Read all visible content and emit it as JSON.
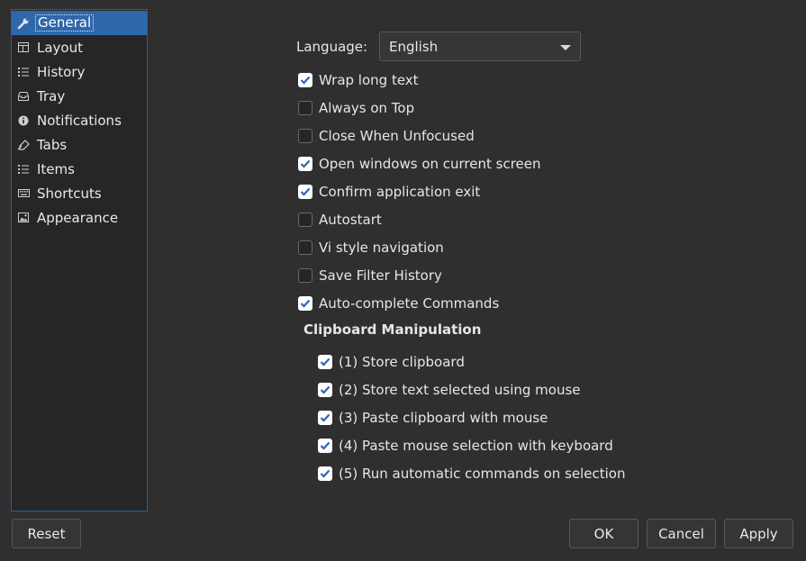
{
  "sidebar": {
    "items": [
      {
        "label": "General",
        "icon": "wrench-icon",
        "selected": true
      },
      {
        "label": "Layout",
        "icon": "layout-icon",
        "selected": false
      },
      {
        "label": "History",
        "icon": "list-icon",
        "selected": false
      },
      {
        "label": "Tray",
        "icon": "tray-icon",
        "selected": false
      },
      {
        "label": "Notifications",
        "icon": "info-icon",
        "selected": false
      },
      {
        "label": "Tabs",
        "icon": "tabs-icon",
        "selected": false
      },
      {
        "label": "Items",
        "icon": "list-icon",
        "selected": false
      },
      {
        "label": "Shortcuts",
        "icon": "keyboard-icon",
        "selected": false
      },
      {
        "label": "Appearance",
        "icon": "image-icon",
        "selected": false
      }
    ]
  },
  "language": {
    "label": "Language:",
    "value": "English"
  },
  "options": [
    {
      "label": "Wrap long text",
      "checked": true
    },
    {
      "label": "Always on Top",
      "checked": false
    },
    {
      "label": "Close When Unfocused",
      "checked": false
    },
    {
      "label": "Open windows on current screen",
      "checked": true
    },
    {
      "label": "Confirm application exit",
      "checked": true
    },
    {
      "label": "Autostart",
      "checked": false
    },
    {
      "label": "Vi style navigation",
      "checked": false
    },
    {
      "label": "Save Filter History",
      "checked": false
    },
    {
      "label": "Auto-complete Commands",
      "checked": true
    }
  ],
  "clipboard": {
    "title": "Clipboard Manipulation",
    "options": [
      {
        "label": "(1) Store clipboard",
        "checked": true
      },
      {
        "label": "(2) Store text selected using mouse",
        "checked": true
      },
      {
        "label": "(3) Paste clipboard with mouse",
        "checked": true
      },
      {
        "label": "(4) Paste mouse selection with keyboard",
        "checked": true
      },
      {
        "label": "(5) Run automatic commands on selection",
        "checked": true
      }
    ]
  },
  "buttons": {
    "reset": "Reset",
    "ok": "OK",
    "cancel": "Cancel",
    "apply": "Apply"
  },
  "colors": {
    "background": "#2f2f2f",
    "selection": "#2f67ab",
    "check_mark": "#2f67ab"
  }
}
